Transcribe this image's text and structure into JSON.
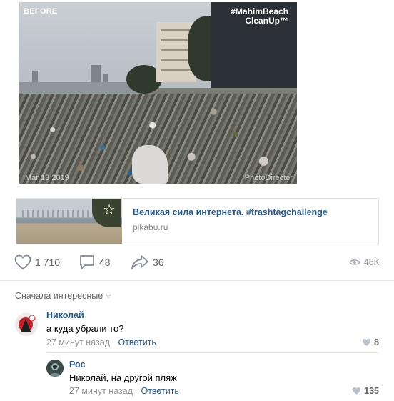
{
  "post": {
    "photo": {
      "label_before": "BEFORE",
      "hashtag_line1": "#MahimBeach",
      "hashtag_line2": "CleanUp™",
      "date": "Mar 13 2019",
      "watermark": "PhotoDirecter"
    },
    "link": {
      "title": "Великая сила интернета. #trashtagchallenge",
      "domain": "pikabu.ru",
      "icon": "star-icon"
    },
    "actions": {
      "likes": "1 710",
      "comments": "48",
      "shares": "36",
      "views": "48K"
    }
  },
  "comments": {
    "sort_label": "Сначала интересные",
    "items": [
      {
        "author": "Николай",
        "text": "а куда убрали то?",
        "time": "27 минут назад",
        "reply_label": "Ответить",
        "likes": "8"
      },
      {
        "author": "Рос",
        "text": "Николай, на другой пляж",
        "time": "27 минут назад",
        "reply_label": "Ответить",
        "likes": "135"
      }
    ]
  },
  "colors": {
    "link": "#2a5885",
    "muted": "#939393",
    "icon": "#656565"
  }
}
